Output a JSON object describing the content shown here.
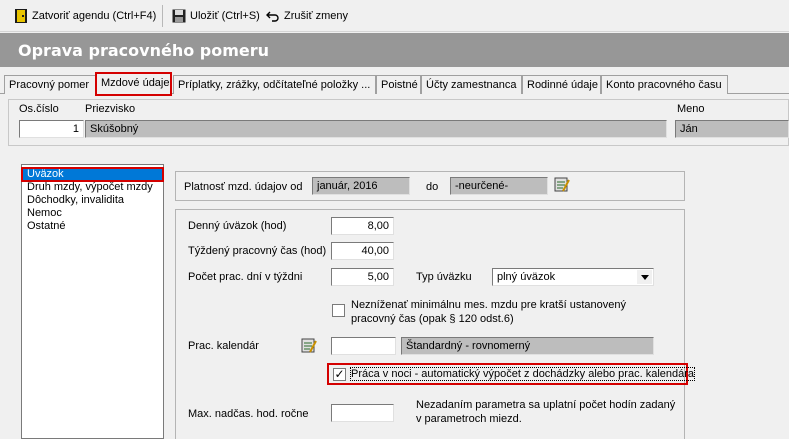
{
  "toolbar": {
    "close_label": "Zatvoriť agendu (Ctrl+F4)",
    "save_label": "Uložiť (Ctrl+S)",
    "cancel_label": "Zrušiť zmeny"
  },
  "window_title": "Oprava pracovného pomeru",
  "tabs": [
    {
      "label": "Pracovný pomer"
    },
    {
      "label": "Mzdové údaje"
    },
    {
      "label": "Príplatky, zrážky, odčítateľné položky ..."
    },
    {
      "label": "Poistné"
    },
    {
      "label": "Účty zamestnanca"
    },
    {
      "label": "Rodinné údaje"
    },
    {
      "label": "Konto pracovného času"
    }
  ],
  "employee": {
    "number_label": "Os.číslo",
    "number_value": "1",
    "surname_label": "Priezvisko",
    "surname_value": "Skúšobný",
    "firstname_label": "Meno",
    "firstname_value": "Ján"
  },
  "sections": [
    {
      "label": "Úväzok"
    },
    {
      "label": "Druh mzdy, výpočet mzdy"
    },
    {
      "label": "Dôchodky, invalidita"
    },
    {
      "label": "Nemoc"
    },
    {
      "label": "Ostatné"
    }
  ],
  "validity": {
    "label": "Platnosť mzd. údajov od",
    "from_value": "január, 2016",
    "to_label": "do",
    "to_value": "-neurčené-"
  },
  "form": {
    "daily_label": "Denný úväzok (hod)",
    "daily_value": "8,00",
    "weekly_label": "Týždený pracovný čas (hod)",
    "weekly_value": "40,00",
    "days_label": "Počet prac. dní v týždni",
    "days_value": "5,00",
    "type_label": "Typ úväzku",
    "type_value": "plný úväzok",
    "min_wage_label": "Nezníženať minimálnu mes. mzdu pre kratší ustanovený pracovný čas (opak § 120 odst.6)",
    "calendar_label": "Prac. kalendár",
    "calendar_code": "",
    "calendar_name": "Štandardný - rovnomerný",
    "night_work_label": "Práca v noci - automatický výpočet z dochádzky alebo prac. kalendára",
    "overtime_label": "Max. nadčas. hod. ročne",
    "overtime_value": "",
    "overtime_note": "Nezadaním parametra sa uplatní počet hodín zadaný v parametroch miezd."
  },
  "checkboxes": {
    "min_wage_checked": false,
    "night_work_checked": true
  },
  "colors": {
    "title_bar": "#979797",
    "selection": "#0078d7",
    "highlight_box": "#d40000",
    "readonly_field": "#bdbdbd"
  }
}
